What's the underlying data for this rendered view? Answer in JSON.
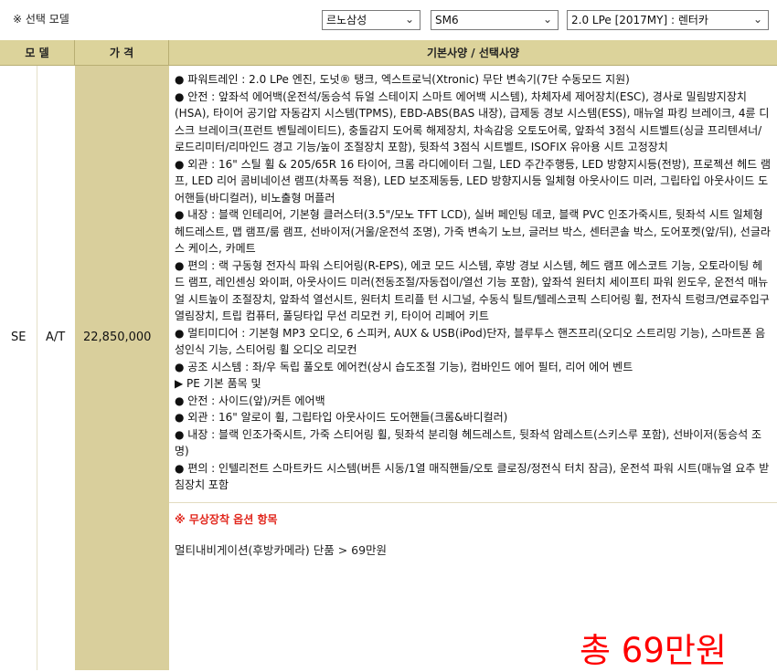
{
  "top": {
    "label": "※ 선택 모델",
    "selects": [
      {
        "value": "르노삼성"
      },
      {
        "value": "SM6"
      },
      {
        "value": "2.0 LPe [2017MY] : 렌터카"
      }
    ]
  },
  "table": {
    "headers": {
      "model": "모 델",
      "price": "가 격",
      "spec": "기본사양 / 선택사양"
    },
    "row": {
      "trim": "SE",
      "transmission": "A/T",
      "price": "22,850,000",
      "spec_lines": [
        "● 파워트레인 : 2.0 LPe 엔진, 도넛® 탱크, 엑스트로닉(Xtronic) 무단 변속기(7단 수동모드 지원)",
        "● 안전 : 앞좌석 에어백(운전석/동승석 듀얼 스테이지 스마트 에어백 시스템), 차체자세 제어장치(ESC), 경사로 밀림방지장치(HSA), 타이어 공기압 자동감지 시스템(TPMS), EBD-ABS(BAS 내장), 급제동 경보 시스템(ESS), 매뉴얼 파킹 브레이크, 4륜 디스크 브레이크(프런트 벤틸레이티드), 충돌감지 도어록 해제장치, 차속감응 오토도어록, 앞좌석 3점식 시트벨트(싱글 프리텐셔너/로드리미터/리마인드 경고 기능/높이 조절장치 포함), 뒷좌석 3점식 시트벨트, ISOFIX 유아용 시트 고정장치",
        "● 외관 : 16\" 스틸 휠 & 205/65R 16 타이어, 크롬 라디에이터 그릴, LED 주간주행등, LED 방향지시등(전방), 프로젝션 헤드 램프, LED 리어 콤비네이션 램프(차폭등 적용), LED 보조제동등, LED 방향지시등 일체형 아웃사이드 미러, 그립타입 아웃사이드 도어핸들(바디컬러), 비노출형 머플러",
        "● 내장 : 블랙 인테리어, 기본형 클러스터(3.5\"/모노 TFT LCD), 실버 페인팅 데코, 블랙 PVC 인조가죽시트, 뒷좌석 시트 일체형 헤드레스트, 맵 램프/룸 램프, 선바이저(거울/운전석 조명), 가죽 변속기 노브, 글러브 박스, 센터콘솔 박스, 도어포켓(앞/뒤), 선글라스 케이스, 카메트",
        "● 편의 : 랙 구동형 전자식 파워 스티어링(R-EPS), 에코 모드 시스템, 후방 경보 시스템, 헤드 램프 에스코트 기능, 오토라이팅 헤드 램프, 레인센싱 와이퍼, 아웃사이드 미러(전동조절/자동접이/열선 기능 포함), 앞좌석 원터치 세이프티 파워 윈도우, 운전석 매뉴얼 시트높이 조절장치, 앞좌석 열선시트, 원터치 트리플 턴 시그널, 수동식 틸트/텔레스코픽 스티어링 휠, 전자식 트렁크/연료주입구 열림장치, 트립 컴퓨터, 풀딩타입 무선 리모컨 키, 타이어 리페어 키트",
        "● 멀티미디어 : 기본형 MP3 오디오, 6 스피커, AUX & USB(iPod)단자, 블루투스 핸즈프리(오디오 스트리밍 기능), 스마트폰 음성인식 기능, 스티어링 휠 오디오 리모컨",
        "● 공조 시스템 : 좌/우 독립 풀오토 에어컨(상시 습도조절 기능), 컴바인드 에어 필터, 리어 에어 벤트",
        "▶ PE 기본 품목 및",
        "● 안전 : 사이드(앞)/커튼 에어백",
        "● 외관 : 16\" 알로이 휠, 그립타입 아웃사이드 도어핸들(크롬&바디컬러)",
        "● 내장 : 블랙 인조가죽시트, 가죽 스티어링 휠, 뒷좌석 분리형 헤드레스트, 뒷좌석 암레스트(스키스루 포함), 선바이저(동승석 조명)",
        "● 편의 : 인텔리전트 스마트카드 시스템(버튼 시동/1열 매직핸들/오토 클로징/정전식 터치 잠금), 운전석 파워 시트(매뉴얼 요추 받침장치 포함"
      ],
      "free_title": "※ 무상장착 옵션 항목",
      "free_item": "멀티내비게이션(후방카메라) 단품 > 69만원",
      "total": "총 69만원"
    }
  },
  "colors": {
    "header_bg": "#dcd39b",
    "price_bg": "#d9cf9c",
    "total_red": "#ff0000",
    "free_red": "#e1261c"
  }
}
